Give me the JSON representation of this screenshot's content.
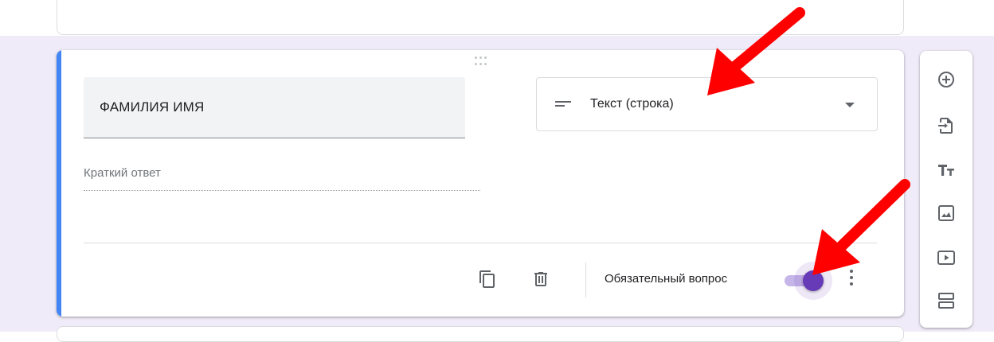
{
  "question": {
    "title": "ФАМИЛИЯ ИМЯ",
    "type_label": "Текст (строка)",
    "type_icon": "short-text-icon",
    "answer_placeholder": "Краткий ответ"
  },
  "footer": {
    "copy_icon": "copy-icon",
    "delete_icon": "delete-icon",
    "required_label": "Обязательный вопрос",
    "required_on": true,
    "more_icon": "more-vert-icon"
  },
  "toolbar": {
    "items": [
      {
        "icon": "add-circle-icon"
      },
      {
        "icon": "import-icon"
      },
      {
        "icon": "title-icon"
      },
      {
        "icon": "image-icon"
      },
      {
        "icon": "video-icon"
      },
      {
        "icon": "section-icon"
      }
    ]
  },
  "colors": {
    "accent": "#4285f4",
    "toggle": "#673ab7",
    "background": "#f0ebf8",
    "annotation_arrow": "#ff0000"
  }
}
